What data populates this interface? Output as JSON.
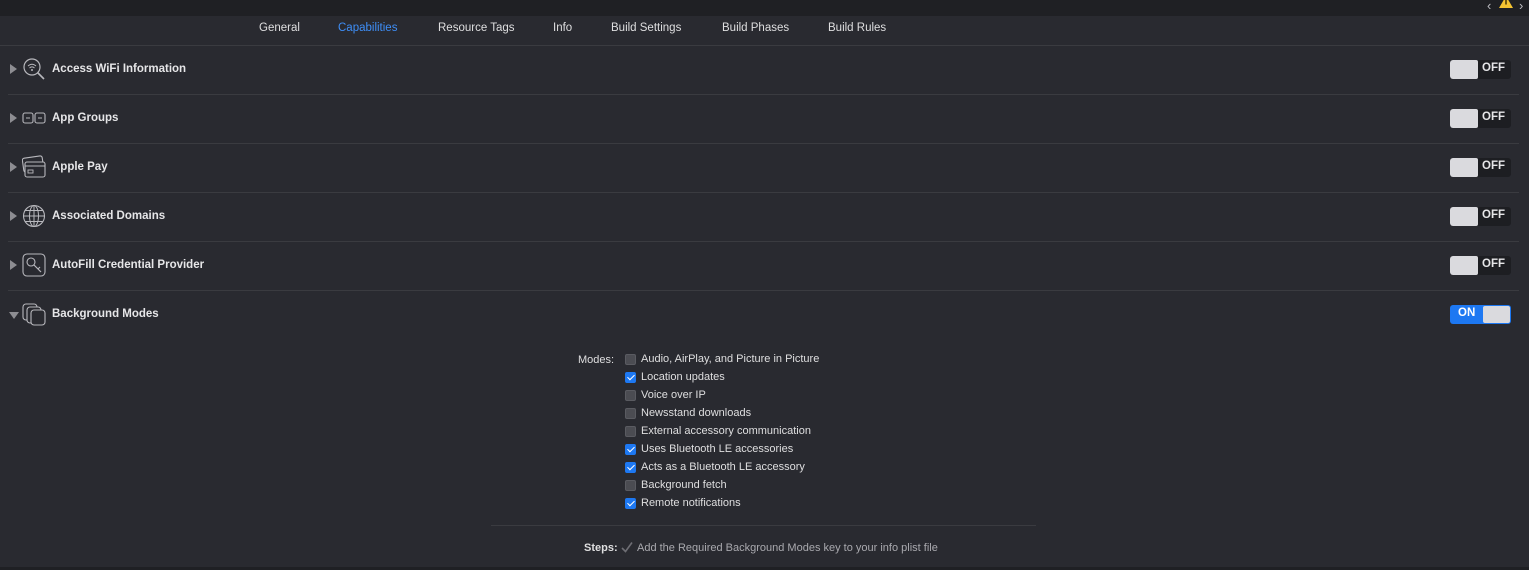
{
  "tabs": [
    {
      "label": "General",
      "active": false
    },
    {
      "label": "Capabilities",
      "active": true
    },
    {
      "label": "Resource Tags",
      "active": false
    },
    {
      "label": "Info",
      "active": false
    },
    {
      "label": "Build Settings",
      "active": false
    },
    {
      "label": "Build Phases",
      "active": false
    },
    {
      "label": "Build Rules",
      "active": false
    }
  ],
  "capabilities": [
    {
      "label": "Access WiFi Information",
      "icon": "wifi-search-icon",
      "state": "OFF",
      "expanded": false
    },
    {
      "label": "App Groups",
      "icon": "app-groups-icon",
      "state": "OFF",
      "expanded": false
    },
    {
      "label": "Apple Pay",
      "icon": "credit-card-icon",
      "state": "OFF",
      "expanded": false
    },
    {
      "label": "Associated Domains",
      "icon": "globe-icon",
      "state": "OFF",
      "expanded": false
    },
    {
      "label": "AutoFill Credential Provider",
      "icon": "key-icon",
      "state": "OFF",
      "expanded": false
    },
    {
      "label": "Background Modes",
      "icon": "background-modes-icon",
      "state": "ON",
      "expanded": true
    }
  ],
  "background_modes": {
    "modes_label": "Modes:",
    "modes": [
      {
        "label": "Audio, AirPlay, and Picture in Picture",
        "checked": false
      },
      {
        "label": "Location updates",
        "checked": true
      },
      {
        "label": "Voice over IP",
        "checked": false
      },
      {
        "label": "Newsstand downloads",
        "checked": false
      },
      {
        "label": "External accessory communication",
        "checked": false
      },
      {
        "label": "Uses Bluetooth LE accessories",
        "checked": true
      },
      {
        "label": "Acts as a Bluetooth LE accessory",
        "checked": true
      },
      {
        "label": "Background fetch",
        "checked": false
      },
      {
        "label": "Remote notifications",
        "checked": true
      }
    ],
    "steps_label": "Steps:",
    "steps_text": "Add the Required Background Modes key to your info plist file"
  },
  "colors": {
    "accent": "#3e8ef7",
    "switch_on": "#1d78f2",
    "background": "#292a30",
    "warning": "#f5c332"
  }
}
